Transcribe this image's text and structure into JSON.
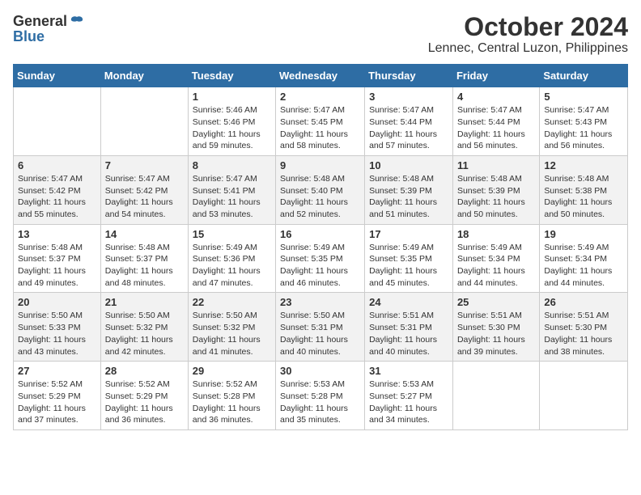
{
  "header": {
    "logo_general": "General",
    "logo_blue": "Blue",
    "month_title": "October 2024",
    "location": "Lennec, Central Luzon, Philippines"
  },
  "columns": [
    "Sunday",
    "Monday",
    "Tuesday",
    "Wednesday",
    "Thursday",
    "Friday",
    "Saturday"
  ],
  "weeks": [
    [
      {
        "day": "",
        "sunrise": "",
        "sunset": "",
        "daylight": ""
      },
      {
        "day": "",
        "sunrise": "",
        "sunset": "",
        "daylight": ""
      },
      {
        "day": "1",
        "sunrise": "Sunrise: 5:46 AM",
        "sunset": "Sunset: 5:46 PM",
        "daylight": "Daylight: 11 hours and 59 minutes."
      },
      {
        "day": "2",
        "sunrise": "Sunrise: 5:47 AM",
        "sunset": "Sunset: 5:45 PM",
        "daylight": "Daylight: 11 hours and 58 minutes."
      },
      {
        "day": "3",
        "sunrise": "Sunrise: 5:47 AM",
        "sunset": "Sunset: 5:44 PM",
        "daylight": "Daylight: 11 hours and 57 minutes."
      },
      {
        "day": "4",
        "sunrise": "Sunrise: 5:47 AM",
        "sunset": "Sunset: 5:44 PM",
        "daylight": "Daylight: 11 hours and 56 minutes."
      },
      {
        "day": "5",
        "sunrise": "Sunrise: 5:47 AM",
        "sunset": "Sunset: 5:43 PM",
        "daylight": "Daylight: 11 hours and 56 minutes."
      }
    ],
    [
      {
        "day": "6",
        "sunrise": "Sunrise: 5:47 AM",
        "sunset": "Sunset: 5:42 PM",
        "daylight": "Daylight: 11 hours and 55 minutes."
      },
      {
        "day": "7",
        "sunrise": "Sunrise: 5:47 AM",
        "sunset": "Sunset: 5:42 PM",
        "daylight": "Daylight: 11 hours and 54 minutes."
      },
      {
        "day": "8",
        "sunrise": "Sunrise: 5:47 AM",
        "sunset": "Sunset: 5:41 PM",
        "daylight": "Daylight: 11 hours and 53 minutes."
      },
      {
        "day": "9",
        "sunrise": "Sunrise: 5:48 AM",
        "sunset": "Sunset: 5:40 PM",
        "daylight": "Daylight: 11 hours and 52 minutes."
      },
      {
        "day": "10",
        "sunrise": "Sunrise: 5:48 AM",
        "sunset": "Sunset: 5:39 PM",
        "daylight": "Daylight: 11 hours and 51 minutes."
      },
      {
        "day": "11",
        "sunrise": "Sunrise: 5:48 AM",
        "sunset": "Sunset: 5:39 PM",
        "daylight": "Daylight: 11 hours and 50 minutes."
      },
      {
        "day": "12",
        "sunrise": "Sunrise: 5:48 AM",
        "sunset": "Sunset: 5:38 PM",
        "daylight": "Daylight: 11 hours and 50 minutes."
      }
    ],
    [
      {
        "day": "13",
        "sunrise": "Sunrise: 5:48 AM",
        "sunset": "Sunset: 5:37 PM",
        "daylight": "Daylight: 11 hours and 49 minutes."
      },
      {
        "day": "14",
        "sunrise": "Sunrise: 5:48 AM",
        "sunset": "Sunset: 5:37 PM",
        "daylight": "Daylight: 11 hours and 48 minutes."
      },
      {
        "day": "15",
        "sunrise": "Sunrise: 5:49 AM",
        "sunset": "Sunset: 5:36 PM",
        "daylight": "Daylight: 11 hours and 47 minutes."
      },
      {
        "day": "16",
        "sunrise": "Sunrise: 5:49 AM",
        "sunset": "Sunset: 5:35 PM",
        "daylight": "Daylight: 11 hours and 46 minutes."
      },
      {
        "day": "17",
        "sunrise": "Sunrise: 5:49 AM",
        "sunset": "Sunset: 5:35 PM",
        "daylight": "Daylight: 11 hours and 45 minutes."
      },
      {
        "day": "18",
        "sunrise": "Sunrise: 5:49 AM",
        "sunset": "Sunset: 5:34 PM",
        "daylight": "Daylight: 11 hours and 44 minutes."
      },
      {
        "day": "19",
        "sunrise": "Sunrise: 5:49 AM",
        "sunset": "Sunset: 5:34 PM",
        "daylight": "Daylight: 11 hours and 44 minutes."
      }
    ],
    [
      {
        "day": "20",
        "sunrise": "Sunrise: 5:50 AM",
        "sunset": "Sunset: 5:33 PM",
        "daylight": "Daylight: 11 hours and 43 minutes."
      },
      {
        "day": "21",
        "sunrise": "Sunrise: 5:50 AM",
        "sunset": "Sunset: 5:32 PM",
        "daylight": "Daylight: 11 hours and 42 minutes."
      },
      {
        "day": "22",
        "sunrise": "Sunrise: 5:50 AM",
        "sunset": "Sunset: 5:32 PM",
        "daylight": "Daylight: 11 hours and 41 minutes."
      },
      {
        "day": "23",
        "sunrise": "Sunrise: 5:50 AM",
        "sunset": "Sunset: 5:31 PM",
        "daylight": "Daylight: 11 hours and 40 minutes."
      },
      {
        "day": "24",
        "sunrise": "Sunrise: 5:51 AM",
        "sunset": "Sunset: 5:31 PM",
        "daylight": "Daylight: 11 hours and 40 minutes."
      },
      {
        "day": "25",
        "sunrise": "Sunrise: 5:51 AM",
        "sunset": "Sunset: 5:30 PM",
        "daylight": "Daylight: 11 hours and 39 minutes."
      },
      {
        "day": "26",
        "sunrise": "Sunrise: 5:51 AM",
        "sunset": "Sunset: 5:30 PM",
        "daylight": "Daylight: 11 hours and 38 minutes."
      }
    ],
    [
      {
        "day": "27",
        "sunrise": "Sunrise: 5:52 AM",
        "sunset": "Sunset: 5:29 PM",
        "daylight": "Daylight: 11 hours and 37 minutes."
      },
      {
        "day": "28",
        "sunrise": "Sunrise: 5:52 AM",
        "sunset": "Sunset: 5:29 PM",
        "daylight": "Daylight: 11 hours and 36 minutes."
      },
      {
        "day": "29",
        "sunrise": "Sunrise: 5:52 AM",
        "sunset": "Sunset: 5:28 PM",
        "daylight": "Daylight: 11 hours and 36 minutes."
      },
      {
        "day": "30",
        "sunrise": "Sunrise: 5:53 AM",
        "sunset": "Sunset: 5:28 PM",
        "daylight": "Daylight: 11 hours and 35 minutes."
      },
      {
        "day": "31",
        "sunrise": "Sunrise: 5:53 AM",
        "sunset": "Sunset: 5:27 PM",
        "daylight": "Daylight: 11 hours and 34 minutes."
      },
      {
        "day": "",
        "sunrise": "",
        "sunset": "",
        "daylight": ""
      },
      {
        "day": "",
        "sunrise": "",
        "sunset": "",
        "daylight": ""
      }
    ]
  ]
}
